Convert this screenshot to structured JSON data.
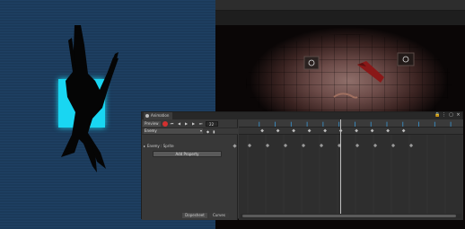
{
  "animation_window": {
    "tab_title": "Animation",
    "preview_label": "Preview",
    "frame_value": "22",
    "clip_name": "Enemy",
    "property_label": "Enemy : Sprite",
    "add_property_label": "Add Property",
    "dopesheet_label": "Dopesheet",
    "curves_label": "Curves"
  },
  "icons": {
    "record": "record-icon",
    "first_key": "first-key-icon",
    "prev_key": "prev-key-icon",
    "play": "play-icon",
    "next_key": "next-key-icon",
    "last_key": "last-key-icon",
    "lock": "lock-icon",
    "menu": "menu-icon",
    "maximize": "maximize-icon",
    "close": "close-icon"
  },
  "colors": {
    "selection": "#19d6f2",
    "record": "#d3302f",
    "ruler_ticks": "#3b8ec4",
    "scene_bg": "#1b3a5a"
  },
  "timeline": {
    "keyframes_count": 10,
    "property_keyframes_count": 10,
    "playhead_frame": 22
  }
}
